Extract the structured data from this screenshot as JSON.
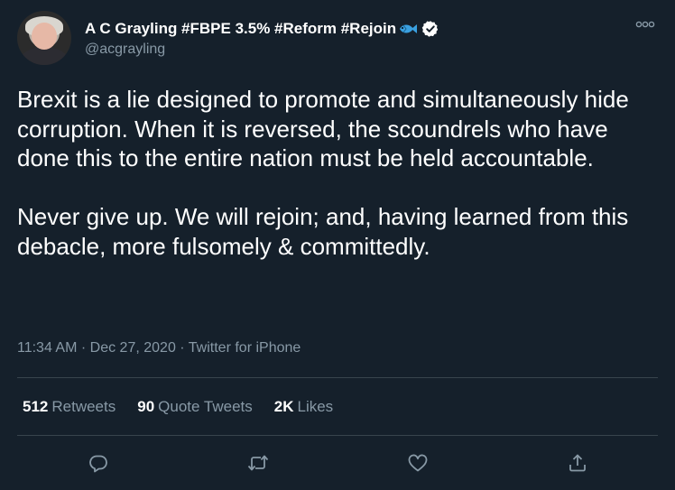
{
  "author": {
    "name": "A C Grayling #FBPE 3.5% #Reform #Rejoin",
    "handle": "@acgrayling"
  },
  "tweet": {
    "paragraph1": "Brexit is a lie designed to promote and simultaneously hide corruption. When it is reversed, the scoundrels who have done this to the entire nation must be held accountable.",
    "paragraph2": "Never give up. We will rejoin; and, having learned from this debacle, more fulsomely & committedly.",
    "time": "11:34 AM",
    "separator": "·",
    "date": "Dec 27, 2020",
    "source": "Twitter for iPhone"
  },
  "stats": {
    "retweets_count": "512",
    "retweets_label": "Retweets",
    "quotes_count": "90",
    "quotes_label": "Quote Tweets",
    "likes_count": "2K",
    "likes_label": "Likes"
  },
  "icons": {
    "fish": "fish-emoji-icon",
    "verified": "verified-badge-icon",
    "more": "more-options-icon",
    "reply": "reply-icon",
    "retweet": "retweet-icon",
    "like": "like-icon",
    "share": "share-icon"
  },
  "colors": {
    "background": "#15202b",
    "text": "#ffffff",
    "secondary_text": "#8899a6",
    "divider": "#38444d",
    "fish": "#3aa0e0"
  }
}
